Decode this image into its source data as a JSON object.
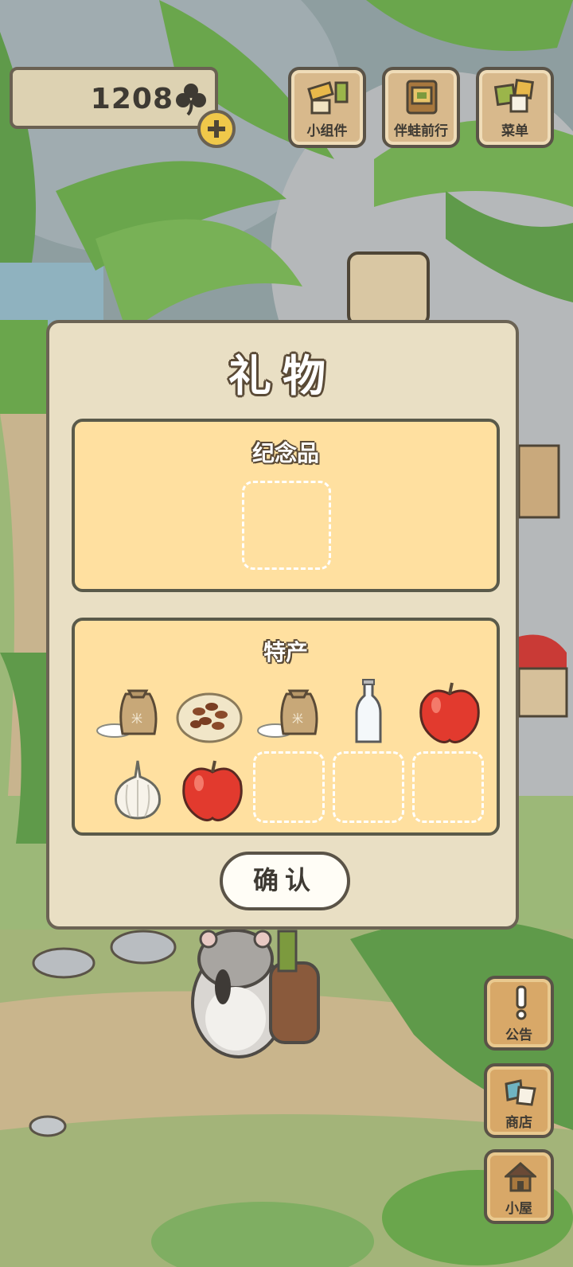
{
  "currency": {
    "count": "1208",
    "icon": "clover-icon"
  },
  "top_buttons": [
    {
      "label": "小组件",
      "icon": "widget-icon"
    },
    {
      "label": "伴蛙前行",
      "icon": "travel-companion-icon"
    },
    {
      "label": "菜单",
      "icon": "menu-cards-icon"
    }
  ],
  "side_buttons": [
    {
      "label": "公告",
      "icon": "exclamation-icon"
    },
    {
      "label": "商店",
      "icon": "shop-bags-icon"
    },
    {
      "label": "小屋",
      "icon": "house-icon"
    }
  ],
  "dialog": {
    "title": "礼物",
    "souvenir_section": {
      "title": "纪念品",
      "slots": [
        "empty"
      ]
    },
    "specialty_section": {
      "title": "特产",
      "items": [
        "rice-bag",
        "almond-plate",
        "rice-bag",
        "glass-bottle",
        "apple",
        "garlic",
        "apple",
        "empty",
        "empty",
        "empty"
      ]
    },
    "confirm_label": "确认"
  },
  "colors": {
    "dialog_bg": "#e9dfc4",
    "panel_bg": "#ffe0a0",
    "button_wood": "#d8a868",
    "border": "#5a5347"
  }
}
